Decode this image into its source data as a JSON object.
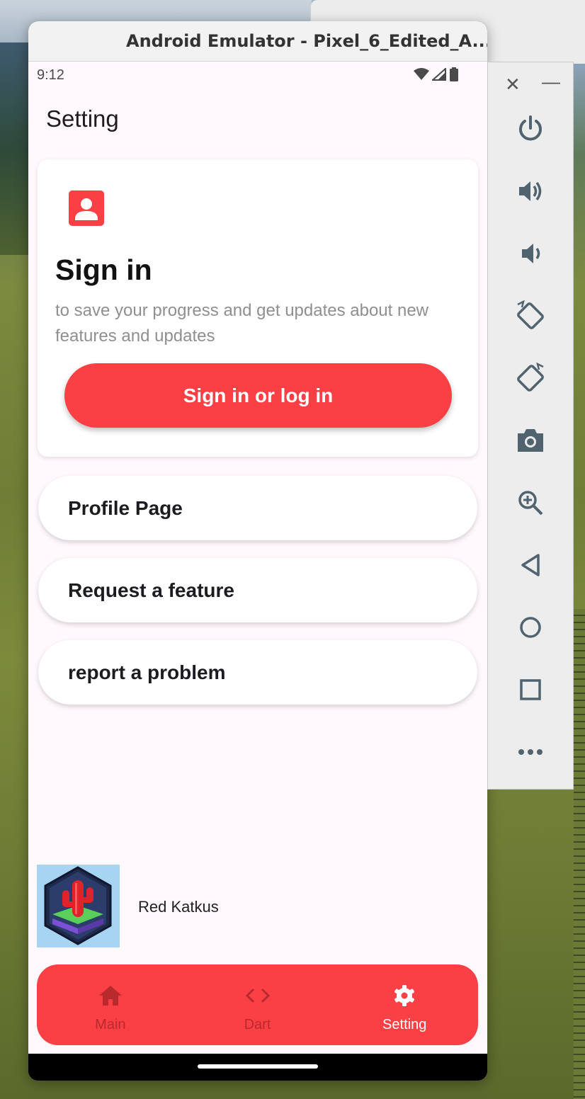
{
  "window": {
    "title": "Android Emulator - Pixel_6_Edited_A..."
  },
  "status_bar": {
    "time": "9:12"
  },
  "app": {
    "page_title": "Setting",
    "signin_card": {
      "heading": "Sign in",
      "description": "to save your progress and get updates about new features and updates",
      "button_label": "Sign in or log in"
    },
    "menu_items": [
      {
        "label": "Profile Page"
      },
      {
        "label": "Request a feature"
      },
      {
        "label": "report a problem"
      }
    ],
    "footer": {
      "app_name": "Red Katkus"
    },
    "bottom_nav": {
      "items": [
        {
          "label": "Main",
          "icon": "home-icon",
          "active": false
        },
        {
          "label": "Dart",
          "icon": "code-icon",
          "active": false
        },
        {
          "label": "Setting",
          "icon": "gear-icon",
          "active": true
        }
      ]
    },
    "colors": {
      "accent": "#fa3f45",
      "background": "#fff8fc"
    }
  },
  "emulator_toolbar": {
    "buttons": [
      "power-icon",
      "volume-up-icon",
      "volume-down-icon",
      "rotate-left-icon",
      "rotate-right-icon",
      "camera-icon",
      "zoom-icon",
      "back-icon",
      "home-circle-icon",
      "overview-icon",
      "more-icon"
    ]
  }
}
